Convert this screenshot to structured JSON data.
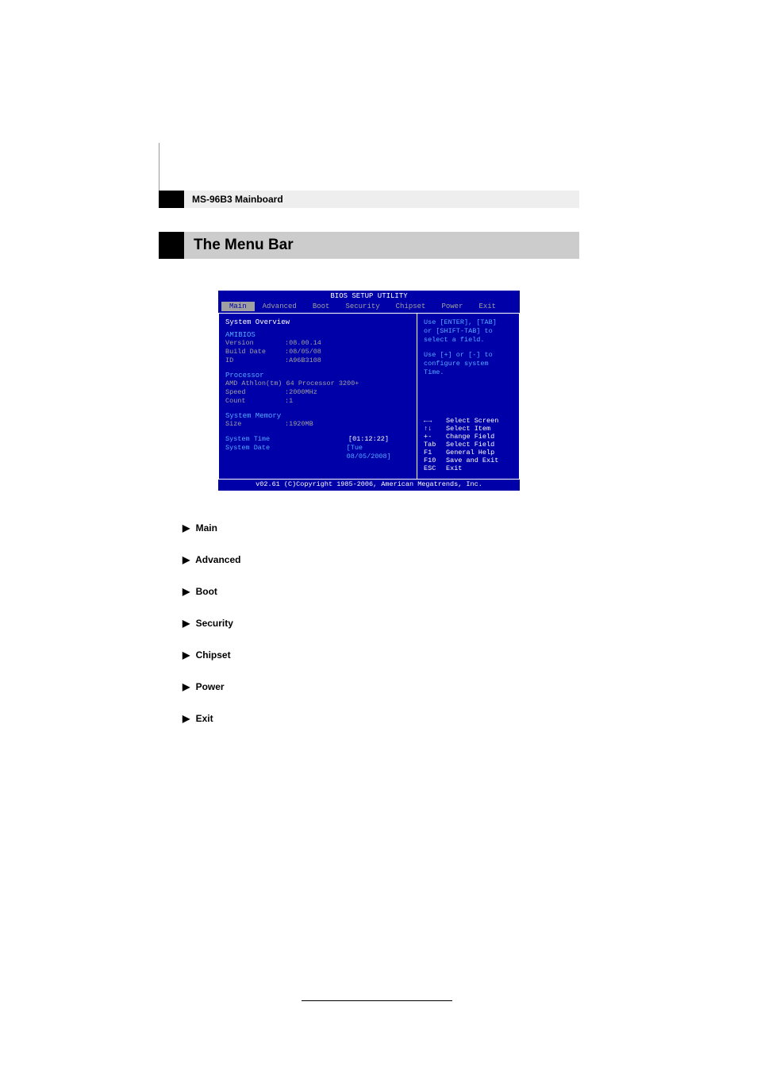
{
  "header": {
    "subtitle": "MS-96B3 Mainboard",
    "title": "The Menu Bar"
  },
  "bios": {
    "title": "BIOS SETUP UTILITY",
    "tabs": [
      "Main",
      "Advanced",
      "Boot",
      "Security",
      "Chipset",
      "Power",
      "Exit"
    ],
    "left": {
      "overview": "System Overview",
      "amibios": "AMIBIOS",
      "version_label": "Version",
      "version_val": ":08.00.14",
      "builddate_label": "Build Date",
      "builddate_val": ":08/05/08",
      "id_label": "ID",
      "id_val": ":A96B3108",
      "processor": "Processor",
      "proc_name": "AMD Athlon(tm) 64 Processor 3200+",
      "speed_label": "Speed",
      "speed_val": ":2000MHz",
      "count_label": "Count",
      "count_val": ":1",
      "sysmem": "System Memory",
      "size_label": "Size",
      "size_val": ":1920MB",
      "systime": "System Time",
      "systime_val": "[01:12:22]",
      "sysdate": "System Date",
      "sysdate_val": "[Tue 08/05/2008]"
    },
    "right": {
      "help1": "Use [ENTER], [TAB]",
      "help2": "or [SHIFT-TAB] to",
      "help3": "select a field.",
      "help4": "Use [+] or [-] to",
      "help5": "configure system Time.",
      "nav1_key": "←→",
      "nav1": "Select Screen",
      "nav2_key": "↑↓",
      "nav2": "Select Item",
      "nav3_key": "+-",
      "nav3": "Change Field",
      "nav4_key": "Tab",
      "nav4": "Select Field",
      "nav5_key": "F1",
      "nav5": "General Help",
      "nav6_key": "F10",
      "nav6": "Save and Exit",
      "nav7_key": "ESC",
      "nav7": "Exit"
    },
    "footer": "v02.61 (C)Copyright 1985-2006, American Megatrends, Inc."
  },
  "sections": {
    "arrow": "▶",
    "items": [
      "Main",
      "Advanced",
      "Boot",
      "Security",
      "Chipset",
      "Power",
      "Exit"
    ]
  }
}
